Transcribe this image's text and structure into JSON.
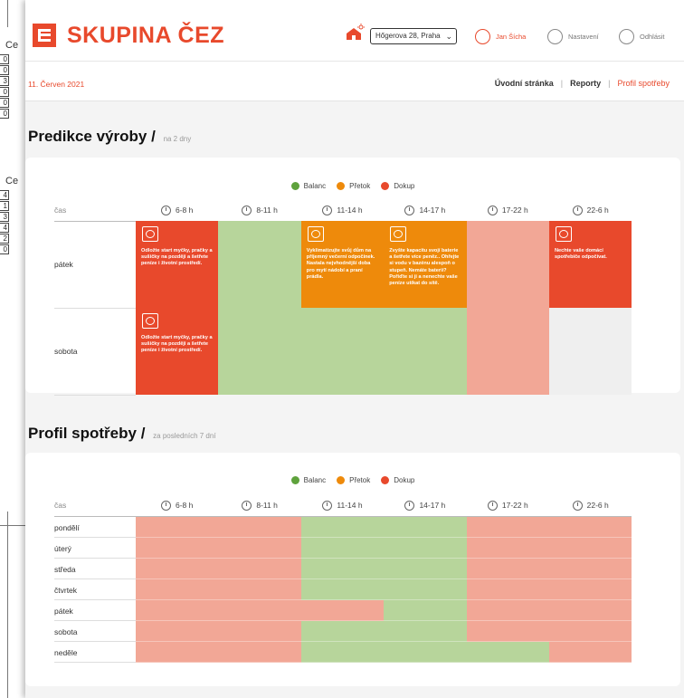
{
  "background_sheet": {
    "label_1": "Ce",
    "label_2": "Ce",
    "cells_1": [
      "0",
      "0",
      "3",
      "0",
      "0",
      "0"
    ],
    "cells_2": [
      "4",
      "1",
      "3",
      "4",
      "2",
      "0"
    ]
  },
  "header": {
    "logo_text": "SKUPINA ČEZ",
    "address": "Hőgerova 28, Praha",
    "user_name": "Jan Šícha",
    "settings_label": "Nastavení",
    "logout_label": "Odhlásit"
  },
  "subheader": {
    "date": "11. Červen 2021",
    "nav": [
      "Úvodní stránka",
      "Reporty",
      "Profil spotřeby"
    ]
  },
  "colors": {
    "balanc": "#b7d59b",
    "pretok": "#ee8a0b",
    "dokup": "#e8492c",
    "dokup_light": "#f2a796",
    "empty": "#efefef"
  },
  "legend": [
    {
      "label": "Balanc",
      "color": "#5ea23c"
    },
    {
      "label": "Přetok",
      "color": "#ee8a0b"
    },
    {
      "label": "Dokup",
      "color": "#e8492c"
    }
  ],
  "time_slots": [
    {
      "label": "6-8 h",
      "icon": "cloud-icon"
    },
    {
      "label": "8-11 h",
      "icon": "cloud-sun-icon"
    },
    {
      "label": "11-14 h",
      "icon": "sun-icon"
    },
    {
      "label": "14-17 h",
      "icon": "sun-cloud-icon"
    },
    {
      "label": "17-22 h",
      "icon": "sunset-icon"
    },
    {
      "label": "22-6 h",
      "icon": "moon-icon"
    }
  ],
  "prediction": {
    "title": "Predikce výroby",
    "subtitle": "na 2 dny",
    "time_header": "čas",
    "rows": [
      {
        "label": "pátek",
        "cells": [
          {
            "state": "dokup",
            "icon": "washing-machine-icon",
            "text": "Odložte start myčky, pračky a sušičky na později a šetřete peníze i životní prostředí."
          },
          {
            "state": "balanc",
            "text": ""
          },
          {
            "state": "pretok",
            "icon": "air-conditioner-icon",
            "text": "Vyklimatizujte svůj dům na příjemný večerní odpočinek. Nastala nejvhodnější doba pro mytí nádobí a praní prádla."
          },
          {
            "state": "pretok",
            "icon": "battery-icon",
            "text": "Zvyšte kapacitu svojí baterie a šetřete více peněz.. Ohřejte si vodu v bazénu alespoň o stupeň. Nemáte baterii? Pořiďte si ji a nenechte vaše peníze utíkat do sítě."
          },
          {
            "state": "dokup_light",
            "text": ""
          },
          {
            "state": "dokup",
            "icon": "washing-machine-icon",
            "text": "Nechte vaše domácí spotřebiče odpočívat."
          }
        ]
      },
      {
        "label": "sobota",
        "cells": [
          {
            "state": "dokup",
            "icon": "washing-machine-icon",
            "text": "Odložte start myčky, pračky a sušičky na později a šetřete peníze i životní prostředí."
          },
          {
            "state": "balanc",
            "text": ""
          },
          {
            "state": "balanc",
            "text": ""
          },
          {
            "state": "balanc",
            "text": ""
          },
          {
            "state": "dokup_light",
            "text": ""
          },
          {
            "state": "empty",
            "text": ""
          }
        ]
      }
    ]
  },
  "profile": {
    "title": "Profil spotřeby",
    "subtitle": "za posledních 7 dní",
    "time_header": "čas",
    "rows": [
      {
        "label": "pondělí",
        "cells": [
          "dokup_light",
          "dokup_light",
          "balanc",
          "balanc",
          "dokup_light",
          "dokup_light"
        ]
      },
      {
        "label": "úterý",
        "cells": [
          "dokup_light",
          "dokup_light",
          "balanc",
          "balanc",
          "dokup_light",
          "dokup_light"
        ]
      },
      {
        "label": "středa",
        "cells": [
          "dokup_light",
          "dokup_light",
          "balanc",
          "balanc",
          "dokup_light",
          "dokup_light"
        ]
      },
      {
        "label": "čtvrtek",
        "cells": [
          "dokup_light",
          "dokup_light",
          "balanc",
          "balanc",
          "dokup_light",
          "dokup_light"
        ]
      },
      {
        "label": "pátek",
        "cells": [
          "dokup_light",
          "dokup_light",
          "dokup_light",
          "balanc",
          "dokup_light",
          "dokup_light"
        ]
      },
      {
        "label": "sobota",
        "cells": [
          "dokup_light",
          "dokup_light",
          "balanc",
          "balanc",
          "dokup_light",
          "dokup_light"
        ]
      },
      {
        "label": "neděle",
        "cells": [
          "dokup_light",
          "dokup_light",
          "balanc",
          "balanc",
          "balanc",
          "dokup_light"
        ]
      }
    ]
  }
}
